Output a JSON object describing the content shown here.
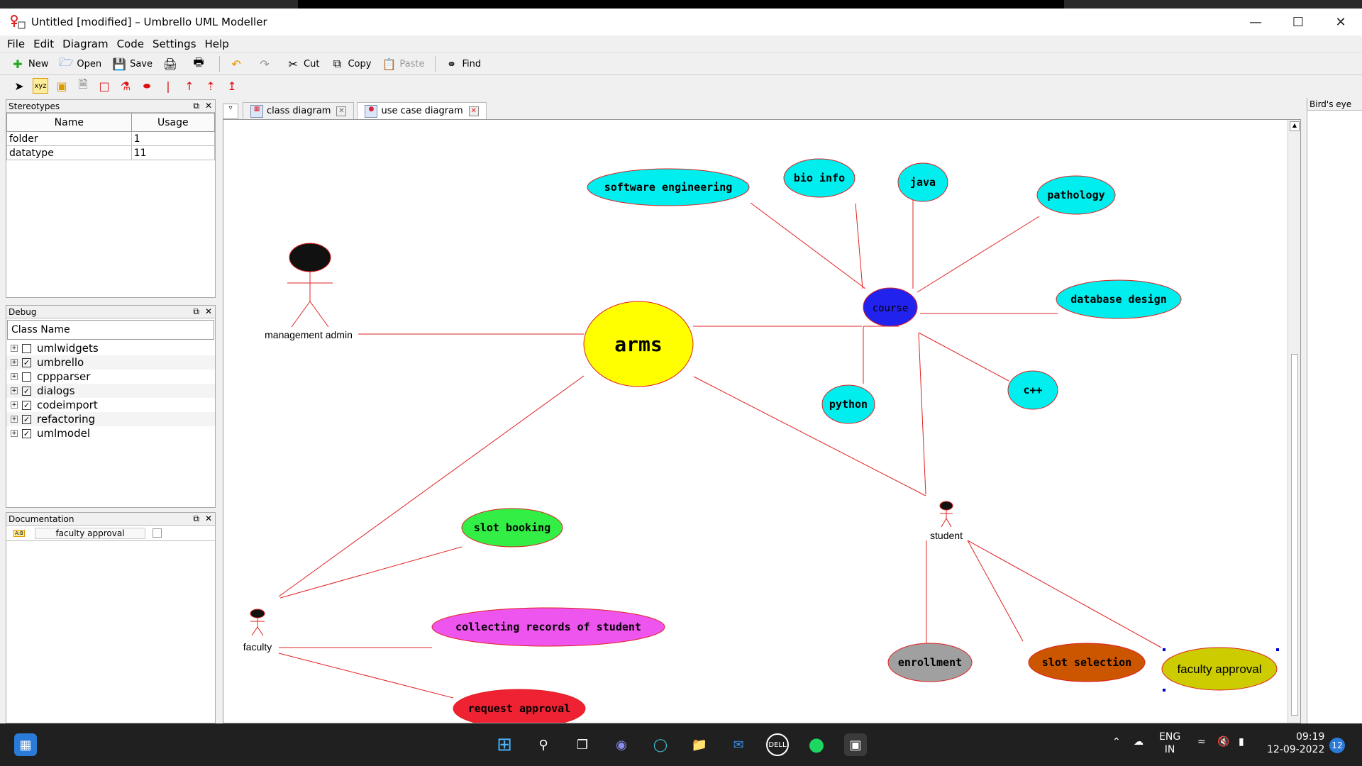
{
  "window": {
    "title": "Untitled [modified] – Umbrello UML Modeller"
  },
  "menu": [
    "File",
    "Edit",
    "Diagram",
    "Code",
    "Settings",
    "Help"
  ],
  "toolbar": {
    "new": "New",
    "open": "Open",
    "save": "Save",
    "cut": "Cut",
    "copy": "Copy",
    "paste": "Paste",
    "find": "Find"
  },
  "stereotypes": {
    "title": "Stereotypes",
    "headers": [
      "Name",
      "Usage"
    ],
    "rows": [
      {
        "name": "folder",
        "usage": "1"
      },
      {
        "name": "datatype",
        "usage": "11"
      }
    ]
  },
  "debug": {
    "title": "Debug",
    "header": "Class Name",
    "items": [
      {
        "label": "umlwidgets",
        "checked": false
      },
      {
        "label": "umbrello",
        "checked": true
      },
      {
        "label": "cppparser",
        "checked": false
      },
      {
        "label": "dialogs",
        "checked": true
      },
      {
        "label": "codeimport",
        "checked": true
      },
      {
        "label": "refactoring",
        "checked": true
      },
      {
        "label": "umlmodel",
        "checked": true
      }
    ]
  },
  "documentation": {
    "title": "Documentation",
    "field": "faculty approval"
  },
  "tabs": [
    "class diagram",
    "use case diagram"
  ],
  "birds_eye": {
    "title": "Bird's eye"
  },
  "diagram": {
    "actors": {
      "management_admin": "management admin",
      "faculty": "faculty",
      "student": "student"
    },
    "usecases": {
      "arms": "arms",
      "course": "course",
      "software_engineering": "software engineering",
      "bio_info": "bio info",
      "java": "java",
      "pathology": "pathology",
      "database_design": "database design",
      "python": "python",
      "cpp": "c++",
      "slot_booking": "slot booking",
      "collecting_records": "collecting records of student",
      "request_approval": "request approval",
      "enrollment": "enrollment",
      "slot_selection": "slot selection",
      "faculty_approval": "faculty approval"
    },
    "colors": {
      "arms": "#ffff00",
      "course": "#2222ee",
      "cyan": "#00eeee",
      "slot_booking": "#33ee44",
      "collecting": "#ee55ee",
      "request": "#ee2233",
      "enrollment": "#a0a0a0",
      "slot_selection": "#cc5500",
      "faculty_approval": "#cccc00",
      "line": "#e02020"
    }
  },
  "taskbar": {
    "lang": "ENG",
    "region": "IN",
    "time": "09:19",
    "date": "12-09-2022",
    "badge": "12"
  }
}
